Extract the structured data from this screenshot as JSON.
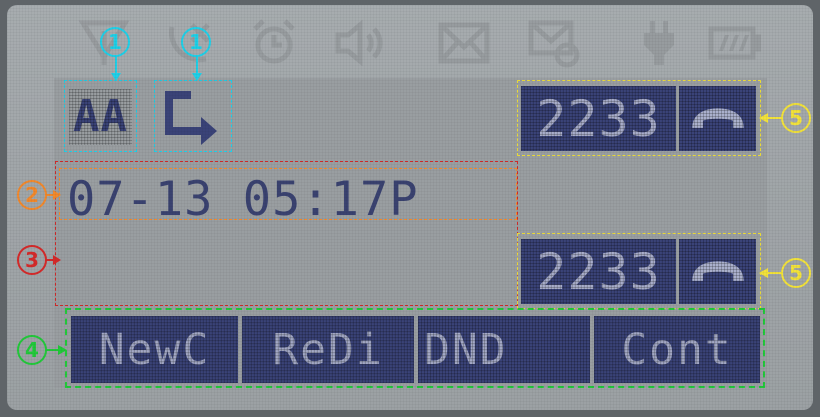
{
  "status_icons": [
    "no-signal-icon",
    "missed-call-icon",
    "alarm-icon",
    "speaker-volume-icon",
    "message-icon",
    "voicemail-icon",
    "power-plug-icon",
    "battery-icon"
  ],
  "indicators": {
    "aa_label": "AA",
    "forward_icon": "call-forward-icon"
  },
  "datetime": "07-13 05:17P",
  "lines": [
    {
      "number": "2233",
      "icon": "handset-icon"
    },
    {
      "number": "2233",
      "icon": "handset-icon"
    }
  ],
  "softkeys": [
    "NewC",
    "ReDi",
    "DND",
    "Cont"
  ],
  "callouts": {
    "c1": "1",
    "c2": "2",
    "c3": "3",
    "c4": "4",
    "c5": "5"
  },
  "colors": {
    "lcd_bg": "#9ea3a6",
    "block_fill": "#3a4378",
    "callout_cyan": "#1fd0e8",
    "callout_orange": "#f2892c",
    "callout_red": "#d42a2a",
    "callout_green": "#22c93a",
    "callout_yellow": "#f2e23a"
  }
}
